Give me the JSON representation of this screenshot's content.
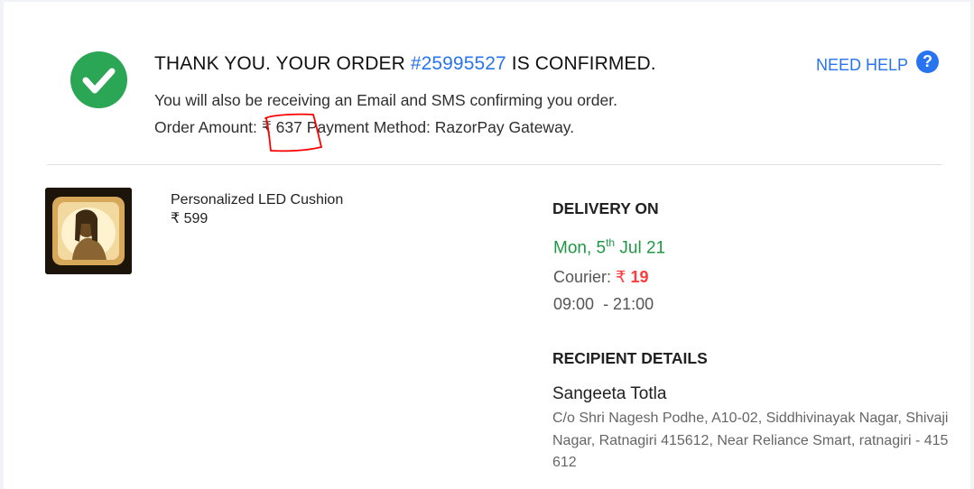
{
  "header": {
    "title_prefix": "THANK YOU. YOUR ORDER ",
    "order_id": "#25995527",
    "title_suffix": " IS CONFIRMED.",
    "confirmation_text": "You will also be receiving an Email and SMS confirming you order.",
    "order_amount_label": "Order Amount:",
    "order_amount_value": "₹ 637",
    "payment_method_label": "Payment Method:",
    "payment_method_value": "RazorPay Gateway."
  },
  "help": {
    "label": "NEED HELP",
    "icon_glyph": "?"
  },
  "product": {
    "name": "Personalized LED Cushion",
    "price": "₹ 599"
  },
  "delivery": {
    "heading": "DELIVERY ON",
    "date_prefix": "Mon, 5",
    "date_sup": "th",
    "date_suffix": " Jul 21",
    "courier_label": "Courier:",
    "courier_currency": "₹",
    "courier_fee": "19",
    "time_start": "09:00",
    "time_end": "- 21:00"
  },
  "recipient": {
    "heading": "RECIPIENT DETAILS",
    "name": "Sangeeta Totla",
    "address": "C/o Shri Nagesh Podhe, A10-02, Siddhivinayak Nagar, Shivaji Nagar, Ratnagiri 415612, Near Reliance Smart, ratnagiri - 415612"
  },
  "colors": {
    "accent": "#2874f0",
    "success": "#2aa655",
    "delivery_date": "#1f9745",
    "fee": "#ff3b3b",
    "annotation": "#ff0000"
  }
}
